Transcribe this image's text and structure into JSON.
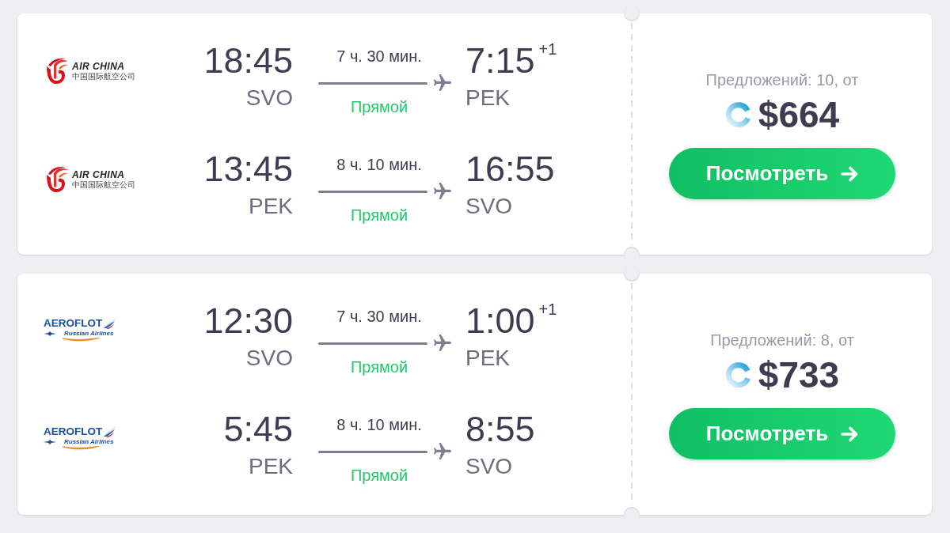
{
  "tickets": [
    {
      "legs": [
        {
          "airline": {
            "kind": "air_china",
            "logo_text": [
              "AIR CHINA",
              "中国国际航空公司"
            ]
          },
          "departure": {
            "time": "18:45",
            "airport": "SVO"
          },
          "duration": "7 ч. 30 мин.",
          "stops": "Прямой",
          "arrival": {
            "time": "7:15",
            "day_offset": "+1",
            "airport": "PEK"
          }
        },
        {
          "airline": {
            "kind": "air_china",
            "logo_text": [
              "AIR CHINA",
              "中国国际航空公司"
            ]
          },
          "departure": {
            "time": "13:45",
            "airport": "PEK"
          },
          "duration": "8 ч. 10 мин.",
          "stops": "Прямой",
          "arrival": {
            "time": "16:55",
            "airport": "SVO"
          }
        }
      ],
      "offers": "Предложений: 10, от",
      "price": "$664",
      "button": "Посмотреть"
    },
    {
      "legs": [
        {
          "airline": {
            "kind": "aeroflot",
            "logo_text": [
              "AEROFLOT",
              "Russian Airlines"
            ]
          },
          "departure": {
            "time": "12:30",
            "airport": "SVO"
          },
          "duration": "7 ч. 30 мин.",
          "stops": "Прямой",
          "arrival": {
            "time": "1:00",
            "day_offset": "+1",
            "airport": "PEK"
          }
        },
        {
          "airline": {
            "kind": "aeroflot",
            "logo_text": [
              "AEROFLOT",
              "Russian Airlines"
            ]
          },
          "departure": {
            "time": "5:45",
            "airport": "PEK"
          },
          "duration": "8 ч. 10 мин.",
          "stops": "Прямой",
          "arrival": {
            "time": "8:55",
            "airport": "SVO"
          }
        }
      ],
      "offers": "Предложений: 8, от",
      "price": "$733",
      "button": "Посмотреть"
    }
  ]
}
